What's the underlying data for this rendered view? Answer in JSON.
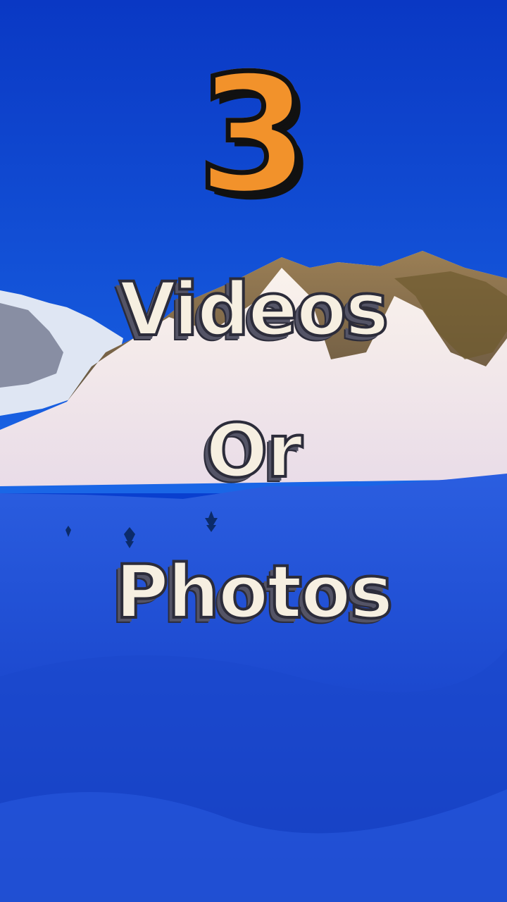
{
  "overlay": {
    "number": "3",
    "line1": "Videos",
    "line2": "Or",
    "line3": "Photos"
  },
  "colors": {
    "sky": "#0a3fcf",
    "number_fill": "#f2922b",
    "text_fill": "#f6efe1",
    "outline": "#111111",
    "snow_shadow": "#1f4fd8",
    "snow_lit": "#f3ece6"
  }
}
